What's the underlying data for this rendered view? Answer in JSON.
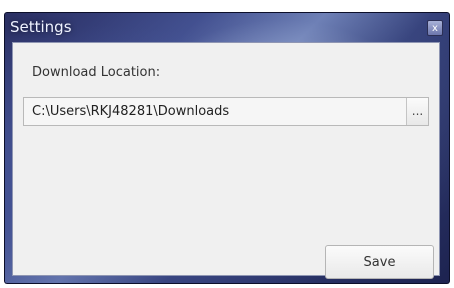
{
  "window": {
    "title": "Settings",
    "close_glyph": "x",
    "close_icon": "close-icon"
  },
  "settings": {
    "download_location_label": "Download Location:",
    "download_location_value": "C:\\Users\\RKJ48281\\Downloads",
    "browse_label": "...",
    "save_label": "Save"
  },
  "colors": {
    "frame_dark": "#2a2f62",
    "frame_highlight": "#6d7fb5",
    "client_background": "#f0f0f0"
  }
}
